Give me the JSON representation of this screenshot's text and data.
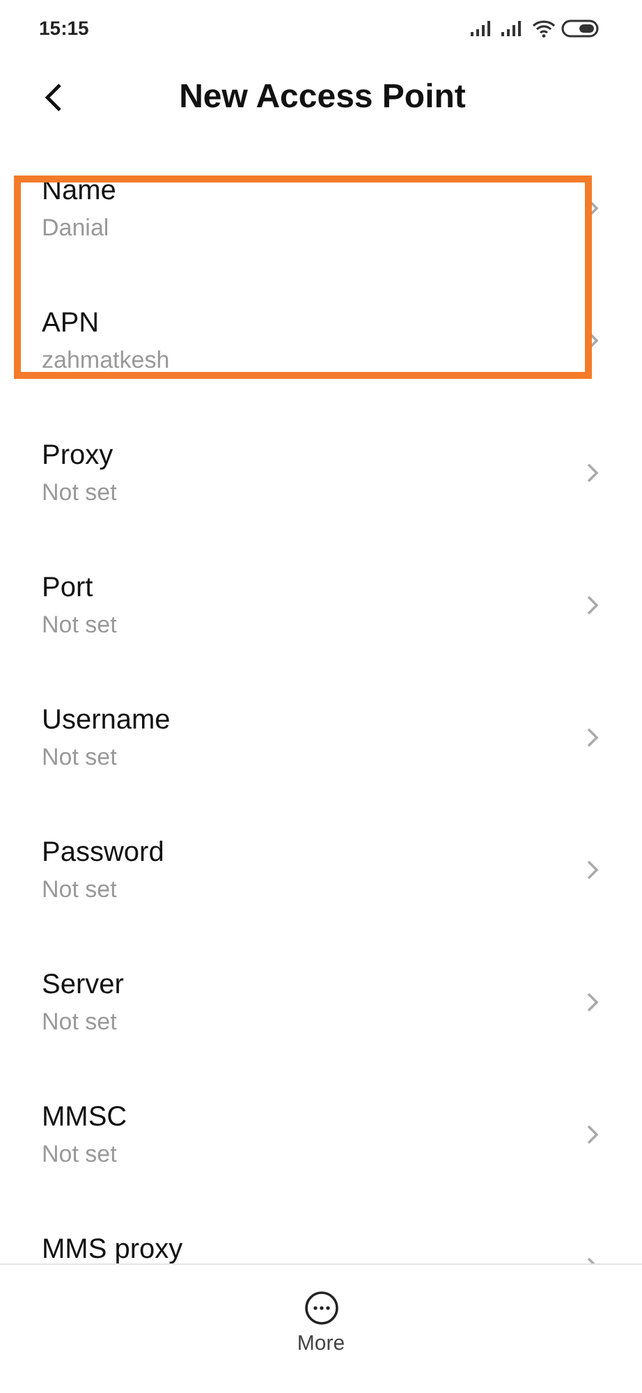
{
  "status_bar": {
    "time": "15:15"
  },
  "header": {
    "title": "New Access Point"
  },
  "items": [
    {
      "label": "Name",
      "value": "Danial",
      "highlighted": true
    },
    {
      "label": "APN",
      "value": "zahmatkesh",
      "highlighted": true
    },
    {
      "label": "Proxy",
      "value": "Not set",
      "highlighted": false
    },
    {
      "label": "Port",
      "value": "Not set",
      "highlighted": false
    },
    {
      "label": "Username",
      "value": "Not set",
      "highlighted": false
    },
    {
      "label": "Password",
      "value": "Not set",
      "highlighted": false
    },
    {
      "label": "Server",
      "value": "Not set",
      "highlighted": false
    },
    {
      "label": "MMSC",
      "value": "Not set",
      "highlighted": false
    },
    {
      "label": "MMS proxy",
      "highlighted": false
    }
  ],
  "bottom_bar": {
    "label": "More"
  }
}
